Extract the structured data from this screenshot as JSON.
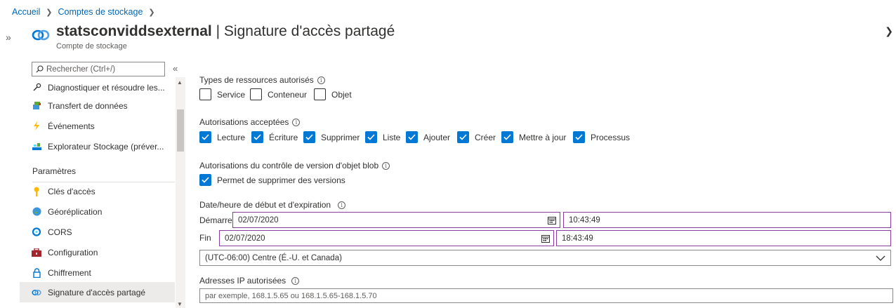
{
  "breadcrumb": {
    "home": "Accueil",
    "storage": "Comptes de stockage"
  },
  "header": {
    "resource_name": "statsconviddsexternal",
    "separator": "|",
    "page_title": "Signature d'accès partagé",
    "subtitle": "Compte de stockage"
  },
  "search": {
    "placeholder": "Rechercher (Ctrl+/)"
  },
  "sidebar": {
    "items": [
      {
        "label": "Diagnostiquer et résoudre les...",
        "icon": "wrench-icon"
      },
      {
        "label": "Transfert de données",
        "icon": "data-transfer-icon"
      },
      {
        "label": "Événements",
        "icon": "lightning-icon"
      },
      {
        "label": "Explorateur Stockage (préver...",
        "icon": "storage-explorer-icon"
      }
    ],
    "section": "Paramètres",
    "settings": [
      {
        "label": "Clés d'accès",
        "icon": "key-icon"
      },
      {
        "label": "Géoréplication",
        "icon": "globe-icon"
      },
      {
        "label": "CORS",
        "icon": "cors-icon"
      },
      {
        "label": "Configuration",
        "icon": "toolbox-icon"
      },
      {
        "label": "Chiffrement",
        "icon": "lock-icon"
      },
      {
        "label": "Signature d'accès partagé",
        "icon": "link-icon"
      }
    ]
  },
  "resource_types": {
    "label": "Types de ressources autorisés",
    "options": [
      {
        "label": "Service",
        "checked": false
      },
      {
        "label": "Conteneur",
        "checked": false
      },
      {
        "label": "Objet",
        "checked": false
      }
    ]
  },
  "permissions": {
    "label": "Autorisations acceptées",
    "options": [
      {
        "label": "Lecture",
        "checked": true
      },
      {
        "label": "Écriture",
        "checked": true
      },
      {
        "label": "Supprimer",
        "checked": true
      },
      {
        "label": "Liste",
        "checked": true
      },
      {
        "label": "Ajouter",
        "checked": true
      },
      {
        "label": "Créer",
        "checked": true
      },
      {
        "label": "Mettre à jour",
        "checked": true
      },
      {
        "label": "Processus",
        "checked": true
      }
    ]
  },
  "versioning": {
    "label": "Autorisations du contrôle de version d'objet blob",
    "option": {
      "label": "Permet de supprimer des versions",
      "checked": true
    }
  },
  "datetime": {
    "label": "Date/heure de début et d'expiration",
    "start_label": "Démarrer",
    "start_date": "02/07/2020",
    "start_time": "10:43:49",
    "end_label": "Fin",
    "end_date": "02/07/2020",
    "end_time": "18:43:49",
    "timezone": "(UTC-06:00) Centre (É.-U. et Canada)"
  },
  "ip": {
    "label": "Adresses IP autorisées",
    "placeholder": "par exemple, 168.1.5.65 ou 168.1.5.65-168.1.5.70"
  },
  "colors": {
    "accent": "#0078d4",
    "link": "#0067b8",
    "active_bg": "#edebe9",
    "input_border_focus": "#8a3ca3"
  }
}
